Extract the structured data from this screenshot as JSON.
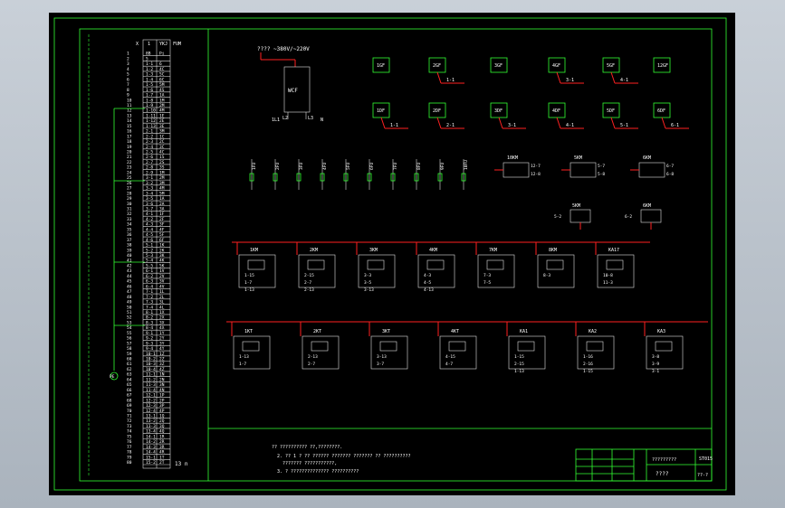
{
  "colors": {
    "background": "#000000",
    "frame": "#33ff33",
    "wire": "#ff2020",
    "text": "#ffffff",
    "viewport": "#b8c0c8"
  },
  "terminal_strip": {
    "header": [
      "X",
      "1",
      "YKJ",
      "FUM"
    ],
    "rows": [
      [
        "1",
        "8B",
        "Pi",
        "1FM"
      ],
      [
        "2",
        "5",
        "",
        " "
      ],
      [
        "3",
        "1-1",
        "6",
        " "
      ],
      [
        "4",
        "1-2",
        "4C",
        " "
      ],
      [
        "5",
        "1-3",
        "5C",
        " "
      ],
      [
        "6",
        "1-4",
        "6C",
        " "
      ],
      [
        "7",
        "1-5",
        "5M",
        " "
      ],
      [
        "8",
        "1-6",
        "4S",
        " "
      ],
      [
        "9",
        "1-7",
        "1A",
        " "
      ],
      [
        "10",
        "1-8",
        "1M",
        " "
      ],
      [
        "11",
        "1-9",
        "2M",
        " "
      ],
      [
        "12",
        "1-10",
        "4M",
        " "
      ],
      [
        "13",
        "1-11",
        "1E",
        " "
      ],
      [
        "14",
        "1-12",
        "2E",
        " "
      ],
      [
        "15",
        "1-13",
        "3E",
        " "
      ],
      [
        "16",
        "2-1",
        "3M",
        " "
      ],
      [
        "17",
        "2-2",
        "1C",
        " "
      ],
      [
        "18",
        "2-3",
        "2C",
        " "
      ],
      [
        "19",
        "2-4",
        "3C",
        " "
      ],
      [
        "20",
        "2-5",
        "4C",
        " "
      ],
      [
        "21",
        "2-6",
        "1S",
        " "
      ],
      [
        "22",
        "2-7",
        "2S",
        " "
      ],
      [
        "23",
        "2-8",
        "3S",
        " "
      ],
      [
        "24",
        "2-9",
        "1M",
        " "
      ],
      [
        "25",
        "3-1",
        "2M",
        " "
      ],
      [
        "26",
        "3-2",
        "3M",
        " "
      ],
      [
        "27",
        "3-3",
        "4M",
        " "
      ],
      [
        "28",
        "3-4",
        "5M",
        " "
      ],
      [
        "29",
        "3-5",
        "1A",
        " "
      ],
      [
        "30",
        "3-6",
        "2A",
        " "
      ],
      [
        "31",
        "3-7",
        "3A",
        " "
      ],
      [
        "32",
        "4-1",
        "1F",
        " "
      ],
      [
        "33",
        "4-2",
        "2F",
        " "
      ],
      [
        "34",
        "4-3",
        "3F",
        " "
      ],
      [
        "35",
        "4-4",
        "4F",
        " "
      ],
      [
        "36",
        "4-5",
        "5F",
        " "
      ],
      [
        "37",
        "4-6",
        "6F",
        " "
      ],
      [
        "38",
        "5-1",
        "1K",
        " "
      ],
      [
        "39",
        "5-2",
        "2K",
        " "
      ],
      [
        "40",
        "5-3",
        "3K",
        " "
      ],
      [
        "41",
        "5-4",
        "4K",
        " "
      ],
      [
        "42",
        "5-5",
        "5K",
        " "
      ],
      [
        "43",
        "6-1",
        "1V",
        " "
      ],
      [
        "44",
        "6-2",
        "2V",
        " "
      ],
      [
        "45",
        "6-3",
        "3V",
        " "
      ],
      [
        "46",
        "6-4",
        "4V",
        " "
      ],
      [
        "47",
        "7-1",
        "1L",
        " "
      ],
      [
        "48",
        "7-2",
        "2L",
        " "
      ],
      [
        "49",
        "7-3",
        "3L",
        " "
      ],
      [
        "50",
        "7-4",
        "4L",
        " "
      ],
      [
        "51",
        "8-1",
        "1X",
        " "
      ],
      [
        "52",
        "8-2",
        "2X",
        " "
      ],
      [
        "53",
        "8-3",
        "3X",
        " "
      ],
      [
        "54",
        "8-4",
        "4X",
        " "
      ],
      [
        "55",
        "9-1",
        "1Y",
        " "
      ],
      [
        "56",
        "9-2",
        "2Y",
        " "
      ],
      [
        "57",
        "9-3",
        "3Y",
        " "
      ],
      [
        "58",
        "9-4",
        "4Y",
        " "
      ],
      [
        "59",
        "10-1",
        "1Z",
        " "
      ],
      [
        "60",
        "10-2",
        "2Z",
        " "
      ],
      [
        "61",
        "10-3",
        "3Z",
        " "
      ],
      [
        "62",
        "10-4",
        "4Z",
        " "
      ],
      [
        "63",
        "11-1",
        "1N",
        " "
      ],
      [
        "64",
        "11-2",
        "2N",
        " "
      ],
      [
        "65",
        "11-3",
        "3N",
        " "
      ],
      [
        "66",
        "11-4",
        "4N",
        " "
      ],
      [
        "67",
        "12-1",
        "1P",
        " "
      ],
      [
        "68",
        "12-2",
        "2P",
        " "
      ],
      [
        "69",
        "12-3",
        "3P",
        " "
      ],
      [
        "70",
        "12-4",
        "4P",
        " "
      ],
      [
        "71",
        "13-1",
        "1Q",
        " "
      ],
      [
        "72",
        "13-2",
        "2Q",
        " "
      ],
      [
        "73",
        "13-3",
        "3Q",
        " "
      ],
      [
        "74",
        "13-4",
        "4Q",
        " "
      ],
      [
        "75",
        "14-1",
        "1R",
        " "
      ],
      [
        "76",
        "14-2",
        "2R",
        " "
      ],
      [
        "77",
        "14-3",
        "3R",
        " "
      ],
      [
        "78",
        "14-4",
        "4R",
        " "
      ],
      [
        "79",
        "15-1",
        "1T",
        " "
      ],
      [
        "80",
        "15-2",
        "2T",
        " "
      ]
    ],
    "tail_label": "13 n",
    "ground_label": "PE"
  },
  "power_supply": {
    "label": "???? ~380V/~220V",
    "box": "WCF",
    "pins": [
      "1L1",
      "L2",
      "L3",
      "N"
    ]
  },
  "relays_top_row1": [
    {
      "name": "1GF",
      "tag": ""
    },
    {
      "name": "2GF",
      "tag": "1-1"
    },
    {
      "name": "3GF",
      "tag": ""
    },
    {
      "name": "4GF",
      "tag": "3-1"
    },
    {
      "name": "5GF",
      "tag": "4-1"
    },
    {
      "name": "12GF",
      "tag": ""
    }
  ],
  "relays_top_row2": [
    {
      "name": "1DF",
      "tag": "1-1"
    },
    {
      "name": "2DF",
      "tag": "2-1"
    },
    {
      "name": "3DF",
      "tag": "3-1"
    },
    {
      "name": "4DF",
      "tag": "4-1"
    },
    {
      "name": "5DF",
      "tag": "5-1"
    },
    {
      "name": "6DF",
      "tag": "6-1"
    }
  ],
  "fuse_row": [
    "1FU",
    "2FU",
    "3FU",
    "4FU",
    "5FU",
    "6FU",
    "7FU",
    "8FU",
    "9FU",
    "10FU"
  ],
  "timer_group": [
    {
      "name": "10KM",
      "pins": [
        "12-7",
        "12-8"
      ]
    },
    {
      "name": "5KM",
      "pins": [
        "5-7",
        "5-8"
      ]
    },
    {
      "name": "6KM",
      "pins": [
        "6-7",
        "6-8"
      ]
    }
  ],
  "small_relays": [
    {
      "name": "5KM",
      "pin": "5-2"
    },
    {
      "name": "6KM",
      "pin": "6-2"
    }
  ],
  "row_a": [
    {
      "name": "1KM",
      "pins": [
        "1-15",
        "1-7",
        "1-13"
      ]
    },
    {
      "name": "2KM",
      "pins": [
        "2-15",
        "2-7",
        "2-13"
      ]
    },
    {
      "name": "3KM",
      "pins": [
        "3-3",
        "3-5",
        "3-13"
      ]
    },
    {
      "name": "4KM",
      "pins": [
        "4-3",
        "4-5",
        "4-13"
      ]
    },
    {
      "name": "7KM",
      "pins": [
        "7-3",
        "7-5"
      ]
    },
    {
      "name": "8KM",
      "pins": [
        "8-3"
      ]
    },
    {
      "name": "KA17",
      "pins": [
        "10-8",
        "11-3"
      ]
    }
  ],
  "row_b": [
    {
      "name": "1KT",
      "pins": [
        "1-13",
        "1-7"
      ]
    },
    {
      "name": "2KT",
      "pins": [
        "2-13",
        "2-7"
      ]
    },
    {
      "name": "3KT",
      "pins": [
        "3-13",
        "3-7"
      ]
    },
    {
      "name": "4KT",
      "pins": [
        "4-15",
        "4-7"
      ]
    },
    {
      "name": "KA1",
      "pins": [
        "1-15",
        "2-15",
        "1-13"
      ]
    },
    {
      "name": "KA2",
      "pins": [
        "1-16",
        "2-16",
        "1-15"
      ]
    },
    {
      "name": "KA3",
      "pins": [
        "3-8",
        "3-9",
        "3-1"
      ]
    }
  ],
  "notes": [
    "?? ?????????? ??,????????.",
    "2. ?? 1 ? ?? ?????? ??????? ??????? ?? ??????????",
    "??????? ???????????,",
    "3. ? ?????????????? ??????????"
  ],
  "title_block": {
    "drawing_title": "?????????",
    "drawing_no": "ST015",
    "name": "????",
    "sheet": "??-?"
  }
}
